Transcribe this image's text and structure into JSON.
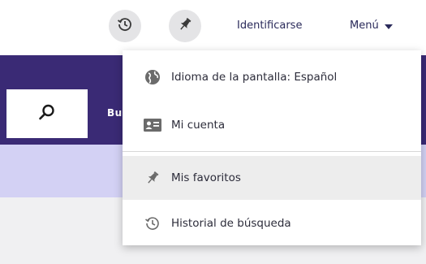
{
  "header": {
    "history_button": {
      "icon": "history-icon"
    },
    "pin_button": {
      "icon": "pin-icon"
    },
    "login_label": "Identificarse",
    "menu_label": "Menú"
  },
  "search": {
    "button_icon": "search-icon",
    "band_text": "Bu"
  },
  "dropdown": {
    "items": [
      {
        "label": "Idioma de la pantalla: Español",
        "icon": "globe-icon"
      },
      {
        "label": "Mi cuenta",
        "icon": "id-card-icon"
      },
      {
        "label": "Mis favoritos",
        "icon": "pin-icon"
      },
      {
        "label": "Historial de búsqueda",
        "icon": "history-icon"
      }
    ]
  },
  "colors": {
    "header_bg": "#ffffff",
    "search_band": "#3a2a75",
    "lilac_strip": "#d3d1f4",
    "grey_area": "#f0f0f2",
    "icon_button_bg": "#e4e4e6",
    "text": "#2c2c3a",
    "highlight": "#ededed"
  }
}
